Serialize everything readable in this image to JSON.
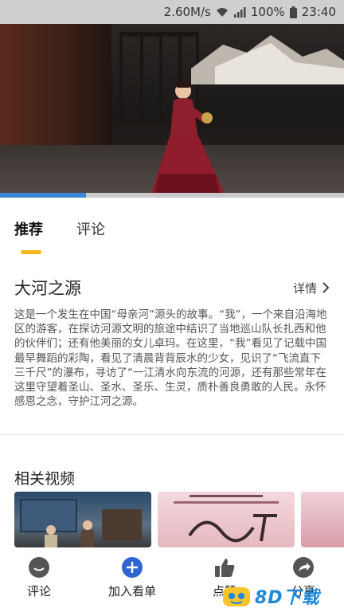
{
  "status_bar": {
    "speed": "2.60M/s",
    "battery": "100%",
    "time": "23:40"
  },
  "video": {
    "progress_fraction": 0.25
  },
  "tabs": [
    {
      "label": "推荐"
    },
    {
      "label": "评论"
    }
  ],
  "show": {
    "title": "大河之源",
    "details_label": "详情",
    "description": "这是一个发生在中国“母亲河”源头的故事。“我”，一个来自沿海地区的游客，在探访河源文明的旅途中结识了当地巡山队长扎西和他的伙伴们；还有他美丽的女儿卓玛。在这里，“我”看见了记载中国最早舞蹈的彩陶，看见了清晨背背辰水的少女，见识了“飞流直下三千尺”的瀑布，寻访了“一江清水向东流的河源，还有那些常年在这里守望着圣山、圣水、圣乐、生灵，质朴善良勇敢的人民。永怀感恩之念，守护江河之源。"
  },
  "related": {
    "title": "相关视频"
  },
  "bottom_bar": {
    "comment": "评论",
    "add_watchlist": "加入看单",
    "like": "点赞",
    "share": "分享"
  },
  "watermark": {
    "text": "8D下载"
  },
  "colors": {
    "accent": "#f5b616",
    "progress": "#3b86d6",
    "add_button": "#2e64d3"
  }
}
